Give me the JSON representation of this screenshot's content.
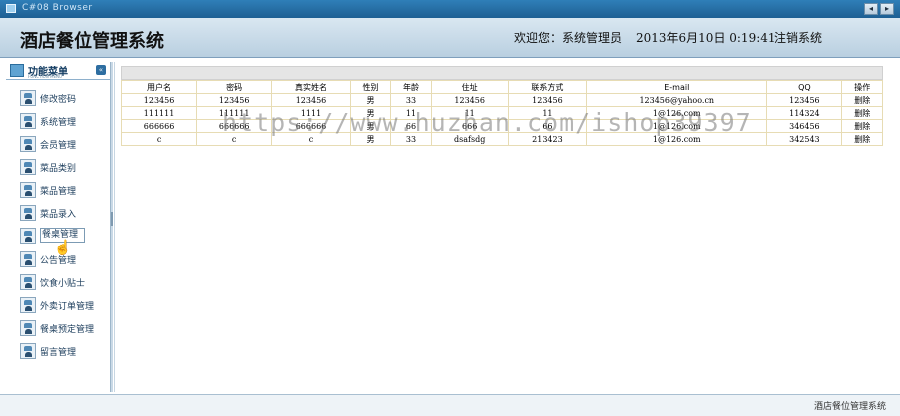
{
  "window": {
    "title": "C#08 Browser"
  },
  "header": {
    "app_title": "酒店餐位管理系统",
    "welcome": "欢迎您：系统管理员",
    "datetime": "2013年6月10日  0:19:41",
    "logout": "注销系统"
  },
  "sidebar": {
    "title": "功能菜单",
    "subtitle": "FUNCTION MENU",
    "toggle": "«",
    "items": [
      {
        "label": "修改密码",
        "icon": "user-icon"
      },
      {
        "label": "系统管理",
        "icon": "user-icon"
      },
      {
        "label": "会员管理",
        "icon": "user-icon"
      },
      {
        "label": "菜品类别",
        "icon": "user-icon"
      },
      {
        "label": "菜品管理",
        "icon": "user-icon"
      },
      {
        "label": "菜品录入",
        "icon": "user-icon"
      },
      {
        "label": "餐桌管理",
        "icon": "user-icon",
        "active": true
      },
      {
        "label": "公告管理",
        "icon": "user-icon"
      },
      {
        "label": "饮食小贴士",
        "icon": "user-icon"
      },
      {
        "label": "外卖订单管理",
        "icon": "user-icon"
      },
      {
        "label": "餐桌预定管理",
        "icon": "user-icon"
      },
      {
        "label": "留言管理",
        "icon": "user-icon"
      }
    ]
  },
  "table": {
    "columns": [
      "用户名",
      "密码",
      "真实姓名",
      "性别",
      "年龄",
      "住址",
      "联系方式",
      "E-mail",
      "QQ",
      "操作"
    ],
    "rows": [
      [
        "123456",
        "123456",
        "123456",
        "男",
        "33",
        "123456",
        "123456",
        "123456@yahoo.cn",
        "123456",
        "删除"
      ],
      [
        "111111",
        "111111",
        "1111",
        "男",
        "11",
        "11",
        "11",
        "1@126.com",
        "114324",
        "删除"
      ],
      [
        "666666",
        "666666",
        "666666",
        "男",
        "66",
        "666",
        "66",
        "1@126.com",
        "346456",
        "删除"
      ],
      [
        "c",
        "c",
        "c",
        "男",
        "33",
        "dsafsdg",
        "213423",
        "1@126.com",
        "342543",
        "删除"
      ]
    ]
  },
  "watermark": "https://www.huzhan.com/ishop39397",
  "status": {
    "text": "酒店餐位管理系统"
  },
  "colors": {
    "header_bg": "#c6d8e7",
    "accent": "#1e5f93"
  }
}
